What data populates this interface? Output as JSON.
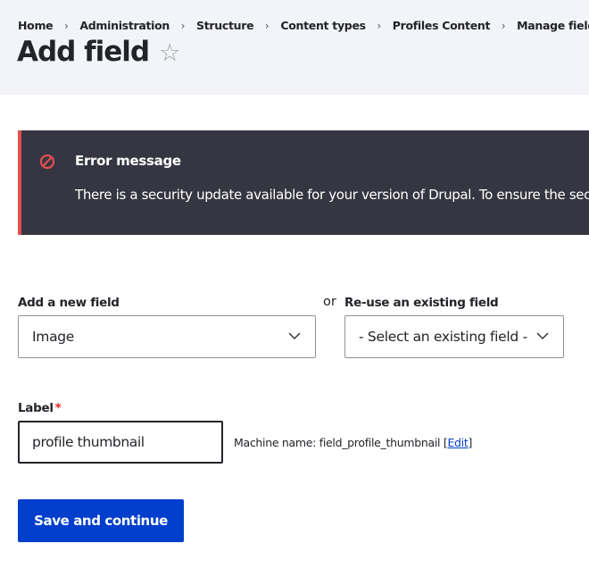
{
  "breadcrumb": [
    {
      "label": "Home"
    },
    {
      "label": "Administration"
    },
    {
      "label": "Structure"
    },
    {
      "label": "Content types"
    },
    {
      "label": "Profiles Content"
    },
    {
      "label": "Manage fields"
    }
  ],
  "breadcrumb_separator": "›",
  "page": {
    "title": "Add field",
    "favorite_icon": "☆"
  },
  "error": {
    "icon": "prohibited-circle-icon",
    "title": "Error message",
    "text": "There is a security update available for your version of Drupal. To ensure the security of your server, you should update immediately!",
    "accent_color": "#e34f4f",
    "background_color": "#353641"
  },
  "form": {
    "new_field": {
      "label": "Add a new field",
      "selected": "Image"
    },
    "or_text": "or",
    "reuse_field": {
      "label": "Re-use an existing field",
      "selected": "- Select an existing field -"
    },
    "label_field": {
      "label": "Label",
      "required_marker": "*",
      "value": "profile thumbnail"
    },
    "machine_name": {
      "prefix": "Machine name: field_profile_thumbnail",
      "open_bracket": "[",
      "edit_link": "Edit",
      "close_bracket": "]"
    },
    "save_label": "Save and continue"
  },
  "colors": {
    "primary": "#003ecc",
    "header_bg": "#f3f4f9",
    "required": "#dc2323"
  }
}
